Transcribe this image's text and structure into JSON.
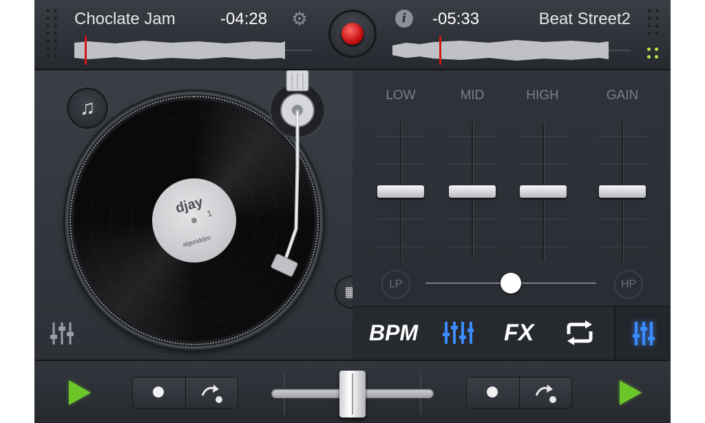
{
  "deck_a": {
    "title": "Choclate Jam",
    "time": "-04:28"
  },
  "deck_b": {
    "title": "Beat Street2",
    "time": "-05:33"
  },
  "record_label": {
    "brand": "djay",
    "side": "1",
    "sub": "algoriddim"
  },
  "mixer": {
    "eq_labels": [
      "LOW",
      "MID",
      "HIGH",
      "GAIN"
    ],
    "filter": {
      "left_label": "LP",
      "right_label": "HP",
      "level": 0.5
    },
    "faders": {
      "low": 0.5,
      "mid": 0.5,
      "high": 0.5,
      "gain": 0.5
    }
  },
  "modes": {
    "bpm": "BPM",
    "fx": "FX"
  },
  "crossfader": {
    "level": 0.5
  },
  "colors": {
    "accent_blue": "#3b8cff",
    "play_green": "#6cc62a",
    "record_red": "#d01818",
    "led_green": "#b6e84a"
  },
  "icons": {
    "settings": "gear-icon",
    "info": "info-icon",
    "record": "record-icon",
    "add_music": "music-add-icon",
    "grid": "grid-icon",
    "eq": "sliders-icon",
    "loop": "loop-icon",
    "play": "play-icon",
    "cue": "cue-dot-icon",
    "skip": "skip-icon"
  }
}
